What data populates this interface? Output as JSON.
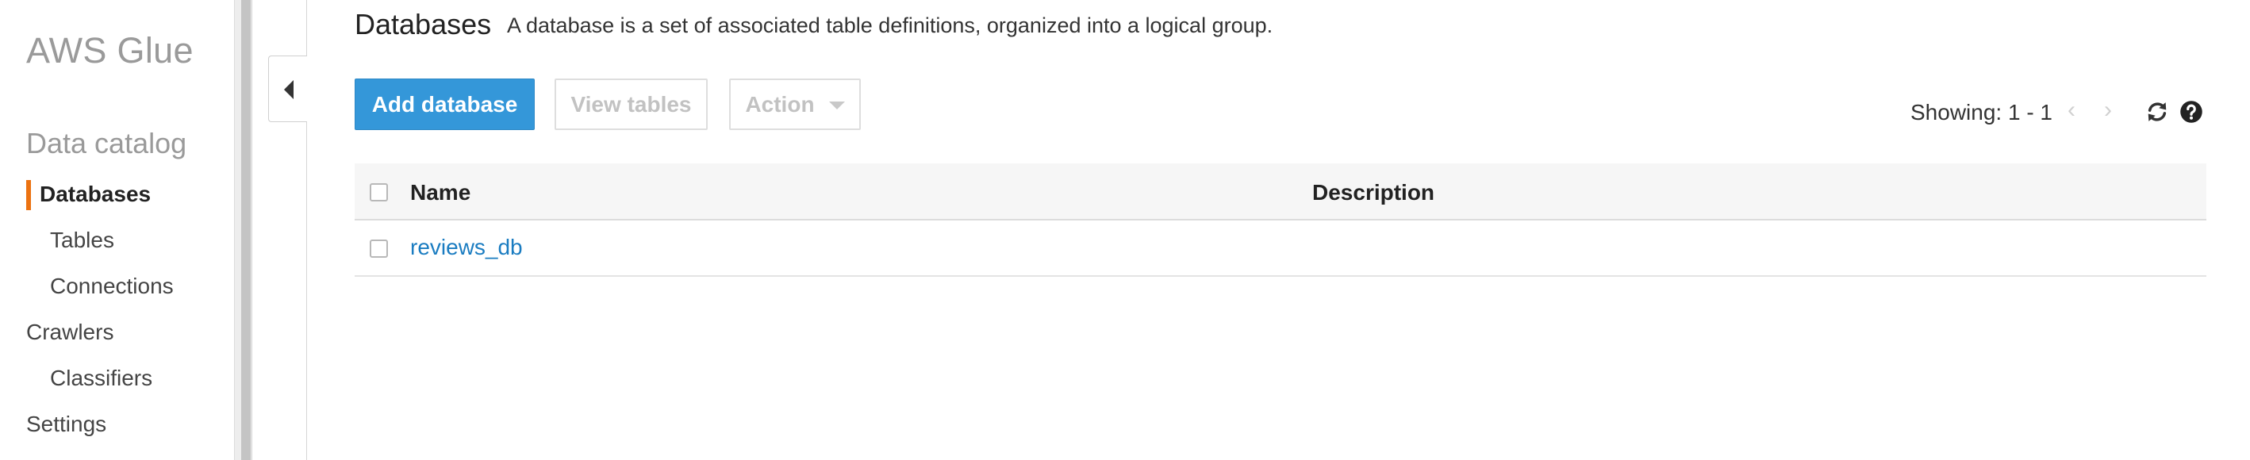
{
  "sidebar": {
    "brand": "AWS Glue",
    "section_title": "Data catalog",
    "items": [
      {
        "label": "Databases"
      },
      {
        "label": "Tables"
      },
      {
        "label": "Connections"
      },
      {
        "label": "Crawlers"
      },
      {
        "label": "Classifiers"
      },
      {
        "label": "Settings"
      }
    ],
    "accent_color": "#ec7211"
  },
  "header": {
    "title": "Databases",
    "description": "A database is a set of associated table definitions, organized into a logical group."
  },
  "toolbar": {
    "add_label": "Add database",
    "view_tables_label": "View tables",
    "action_label": "Action",
    "showing": "Showing: 1 - 1",
    "prev_glyph": "‹",
    "next_glyph": "›",
    "refresh_icon": "refresh-icon",
    "help_icon": "help-icon"
  },
  "table": {
    "columns": [
      "Name",
      "Description"
    ],
    "rows": [
      {
        "name": "reviews_db",
        "description": ""
      }
    ]
  },
  "colors": {
    "primary": "#3497d9",
    "link": "#1a7cc1"
  }
}
